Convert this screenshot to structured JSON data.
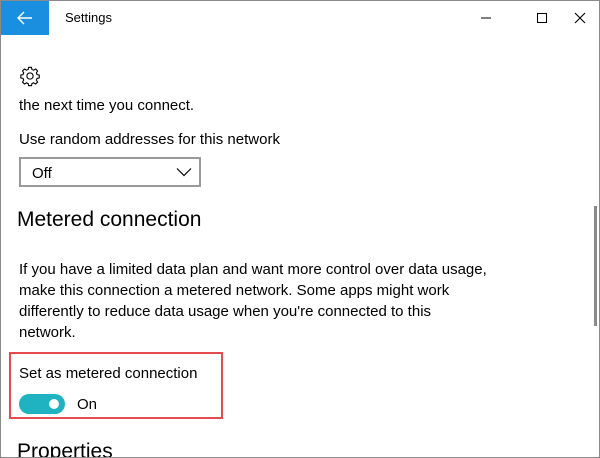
{
  "window": {
    "title": "Settings"
  },
  "titlebar": {
    "back_icon": "back-arrow-icon",
    "controls": [
      "minimize-icon",
      "maximize-icon",
      "close-icon"
    ]
  },
  "content": {
    "settings_icon": "gear-icon",
    "intro_text": "the next time you connect.",
    "random_addresses": {
      "label": "Use random addresses for this network",
      "selected": "Off"
    },
    "metered": {
      "title": "Metered connection",
      "description": "If you have a limited data plan and want more control over data usage, make this connection a metered network. Some apps might work differently to reduce data usage when you're connected to this network.",
      "toggle_label": "Set as metered connection",
      "toggle_state": "On",
      "toggle_on": true
    },
    "properties_title": "Properties"
  },
  "colors": {
    "accent": "#1a8fe0",
    "toggle_on": "#1fb2c0",
    "highlight": "#e74c4c"
  }
}
